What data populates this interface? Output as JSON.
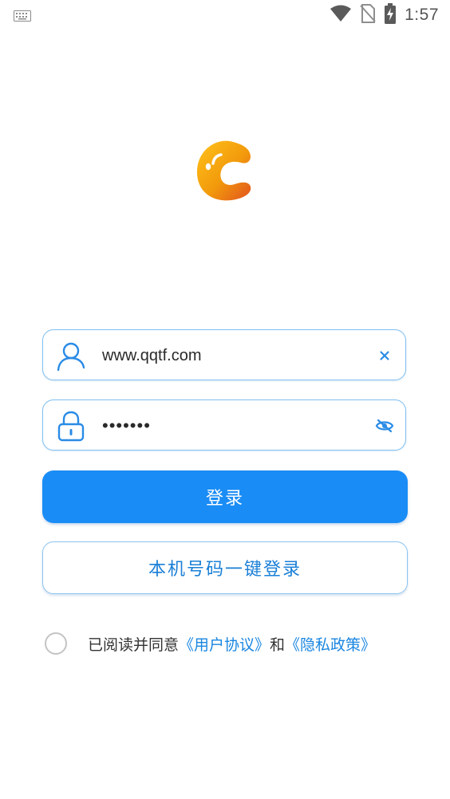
{
  "status_bar": {
    "time": "1:57",
    "icons": [
      "keyboard-icon",
      "wifi-icon",
      "no-sim-icon",
      "battery-charging-icon"
    ]
  },
  "logo": {
    "icon": "app-logo-icon",
    "gradient_colors": [
      "#ffc21a",
      "#f29a0c",
      "#e2531d"
    ]
  },
  "account_field": {
    "icon": "user-icon",
    "value": "www.qqtf.com",
    "clear_icon": "clear-icon"
  },
  "password_field": {
    "icon": "lock-icon",
    "value": "•••••••",
    "toggle_icon": "eye-off-icon"
  },
  "login_button": {
    "label": "登录"
  },
  "onekey_button": {
    "label": "本机号码一键登录"
  },
  "agreement": {
    "prefix": "已阅读并同意",
    "user_agreement": "《用户协议》",
    "connector": "和",
    "privacy_policy": "《隐私政策》"
  },
  "colors": {
    "primary": "#1a8cf5",
    "field_border": "#7fbff0",
    "link": "#1a86e0",
    "icon_blue": "#2a8be6"
  }
}
